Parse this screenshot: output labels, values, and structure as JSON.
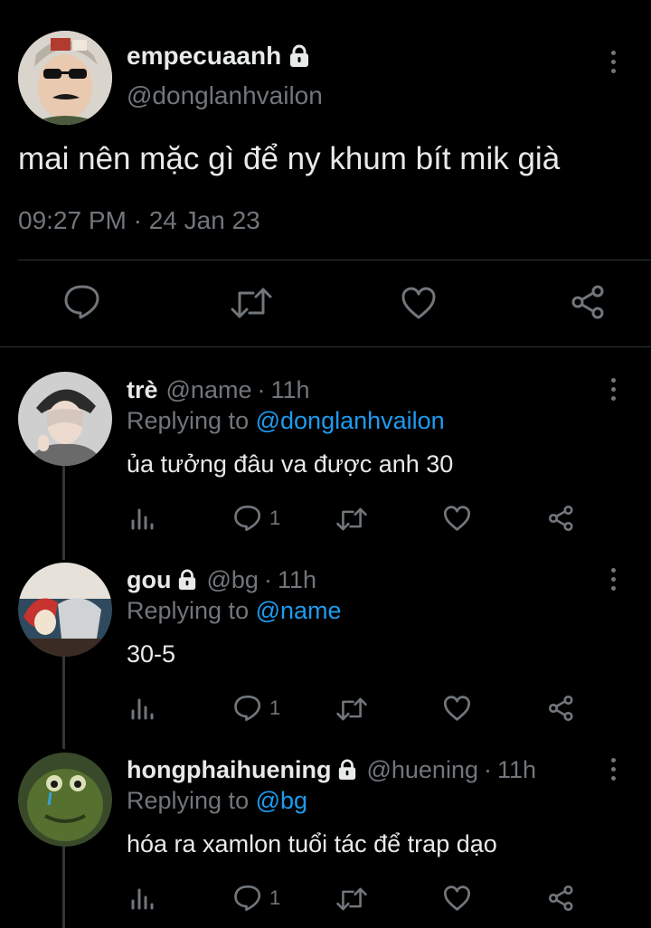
{
  "main_tweet": {
    "display_name": "empecuaanh",
    "handle": "@donglanhvailon",
    "text": "mai nên mặc gì để ny khum bít mik già",
    "timestamp": "09:27 PM · 24 Jan 23",
    "avatar_icon": "profile-photo-sunglasses",
    "locked_icon": "lock-icon",
    "actions": [
      "reply-icon",
      "retweet-icon",
      "like-icon",
      "share-icon"
    ]
  },
  "replies": [
    {
      "display_name": "trè",
      "handle": "@name",
      "time": "11h",
      "replying_prefix": "Replying to",
      "replying_to": "@donglanhvailon",
      "text": "ủa tưởng đâu va được anh 30",
      "reply_count": "1",
      "locked": false
    },
    {
      "display_name": "gou",
      "handle": "@bg",
      "time": "11h",
      "replying_prefix": "Replying to",
      "replying_to": "@name",
      "text": "30-5",
      "reply_count": "1",
      "locked": true
    },
    {
      "display_name": "hongphaihuening",
      "handle": "@huening",
      "time": "11h",
      "replying_prefix": "Replying to",
      "replying_to": "@bg",
      "text": "hóa ra xamlon tuổi tác để trap dạo",
      "reply_count": "1",
      "locked": true
    }
  ],
  "colors": {
    "background": "#000000",
    "text": "#e7e9ea",
    "muted": "#71767b",
    "link": "#1d9bf0",
    "divider": "#2f3336"
  }
}
